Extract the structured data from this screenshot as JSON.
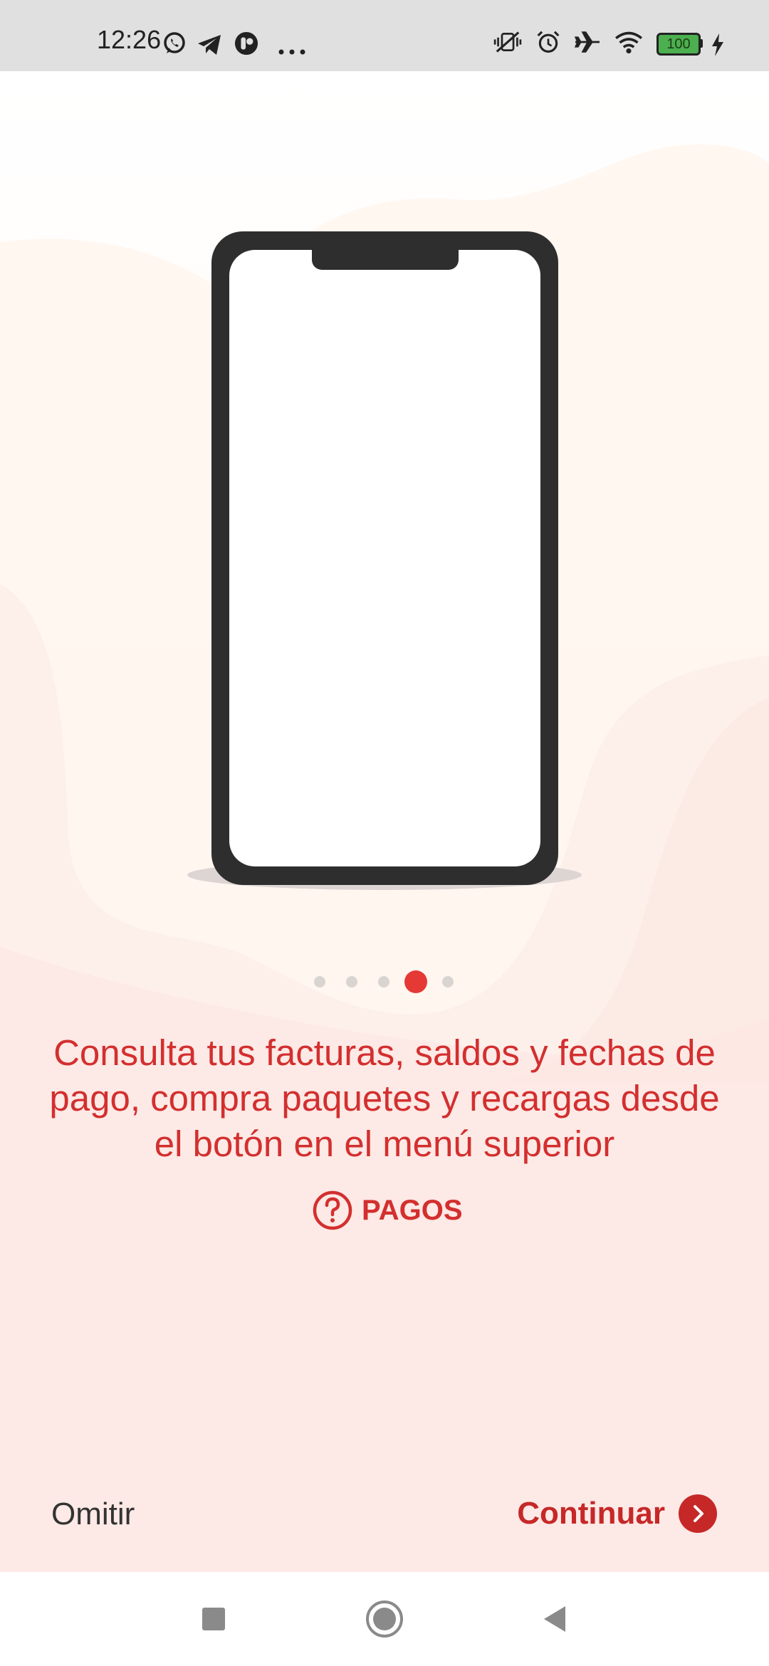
{
  "status_bar": {
    "time": "12:26",
    "left_icons": [
      "whatsapp-icon",
      "telegram-icon",
      "app-icon",
      "more-icon"
    ],
    "right_icons": [
      "mute-vibrate-icon",
      "alarm-icon",
      "airplane-icon",
      "wifi-icon",
      "battery-icon",
      "charging-icon"
    ],
    "battery_level": "100",
    "battery_color": "#4caf50"
  },
  "onboarding": {
    "page_count": 5,
    "active_page": 4,
    "description": "Consulta tus facturas, saldos y fechas de pago, compra paquetes y recargas desde el botón en el menú superior",
    "feature_icon": "question-circle-icon",
    "feature_label": "PAGOS",
    "skip_label": "Omitir",
    "continue_label": "Continuar",
    "continue_icon": "chevron-right-circle-icon"
  },
  "nav_bar": {
    "buttons": [
      "recents-square-icon",
      "home-circle-icon",
      "back-triangle-icon"
    ]
  },
  "colors": {
    "accent": "#e53935",
    "text_red": "#d32f2f",
    "continue_red": "#c62828",
    "phone_frame": "#2e2e2e"
  }
}
